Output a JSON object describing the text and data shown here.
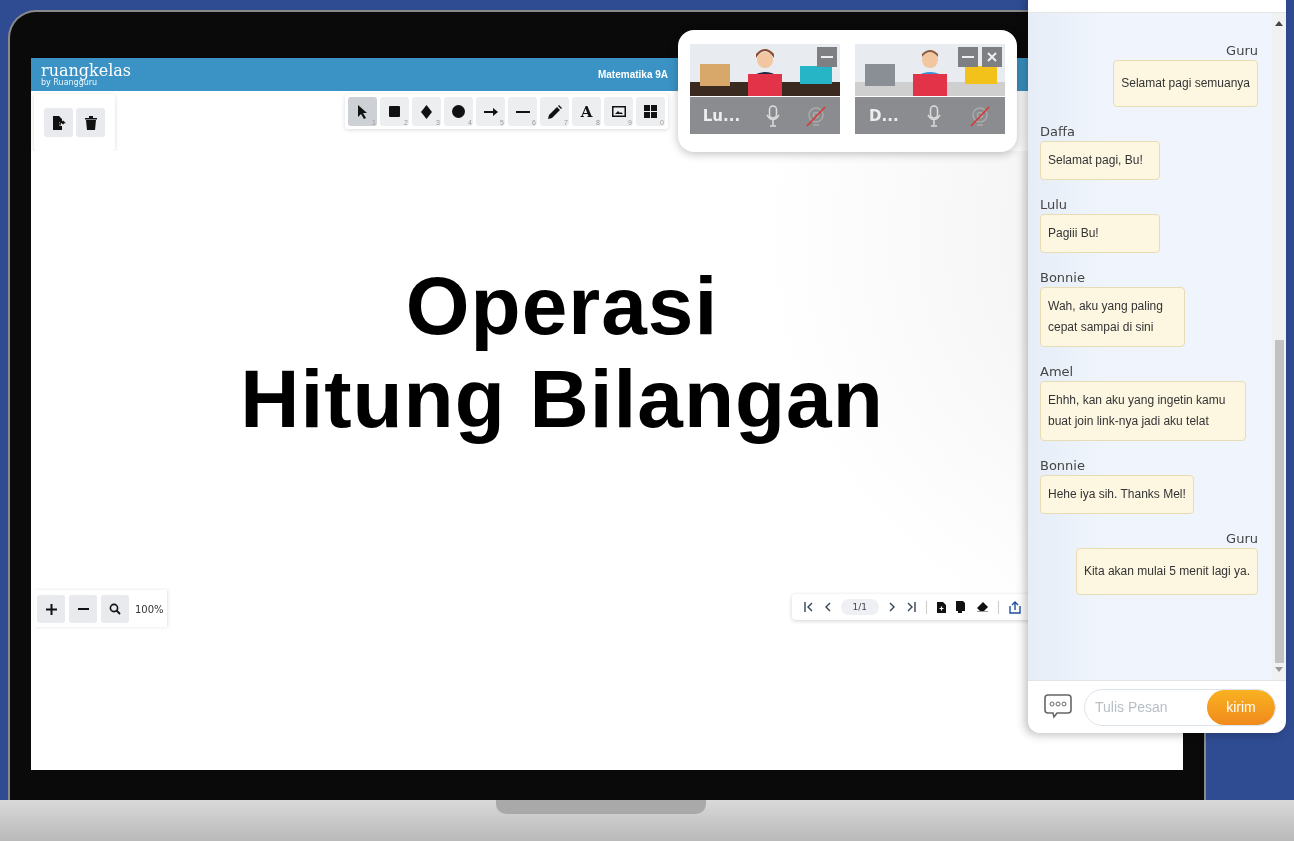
{
  "header": {
    "logo": "ruangkelas",
    "tagline": "by Ruangguru",
    "class_title": "Matematika 9A"
  },
  "tools": [
    {
      "kind": "select",
      "key": "1",
      "selected": true
    },
    {
      "kind": "rectangle",
      "key": "2",
      "selected": false
    },
    {
      "kind": "diamond",
      "key": "3",
      "selected": false
    },
    {
      "kind": "circle",
      "key": "4",
      "selected": false
    },
    {
      "kind": "arrow",
      "key": "5",
      "selected": false
    },
    {
      "kind": "line",
      "key": "6",
      "selected": false
    },
    {
      "kind": "pencil",
      "key": "7",
      "selected": false
    },
    {
      "kind": "text",
      "key": "8",
      "label": "A",
      "selected": false
    },
    {
      "kind": "image",
      "key": "9",
      "selected": false
    },
    {
      "kind": "grid",
      "key": "0",
      "selected": false
    }
  ],
  "heading": [
    "Operasi",
    "Hitung Bilangan"
  ],
  "zoom": {
    "reading": "100%"
  },
  "pager": {
    "page": "1/1"
  },
  "video_tiles": [
    {
      "name": "Lu...",
      "kind": "woman",
      "camera_off": true,
      "closable": false
    },
    {
      "name": "D...",
      "kind": "man",
      "camera_off": true,
      "closable": true
    }
  ],
  "chat": {
    "messages": [
      {
        "sender": "Guru",
        "text": "Selamat pagi semuanya",
        "kind": "outgoing"
      },
      {
        "sender": "Daffa",
        "text": "Selamat pagi, Bu!",
        "kind": "incoming"
      },
      {
        "sender": "Lulu",
        "text": "Pagiii Bu!",
        "kind": "incoming"
      },
      {
        "sender": "Bonnie",
        "text": "Wah, aku yang paling cepat sampai di sini",
        "kind": "incoming"
      },
      {
        "sender": "Amel",
        "text": "Ehhh, kan aku yang ingetin kamu buat join link-nya jadi aku telat",
        "kind": "incoming"
      },
      {
        "sender": "Bonnie",
        "text": "Hehe iya sih. Thanks Mel!",
        "kind": "incoming"
      },
      {
        "sender": "Guru",
        "text": "Kita akan mulai 5 menit lagi ya.",
        "kind": "outgoing"
      }
    ],
    "input": {
      "placeholder": "Tulis Pesan"
    },
    "send_button": "kirim"
  }
}
